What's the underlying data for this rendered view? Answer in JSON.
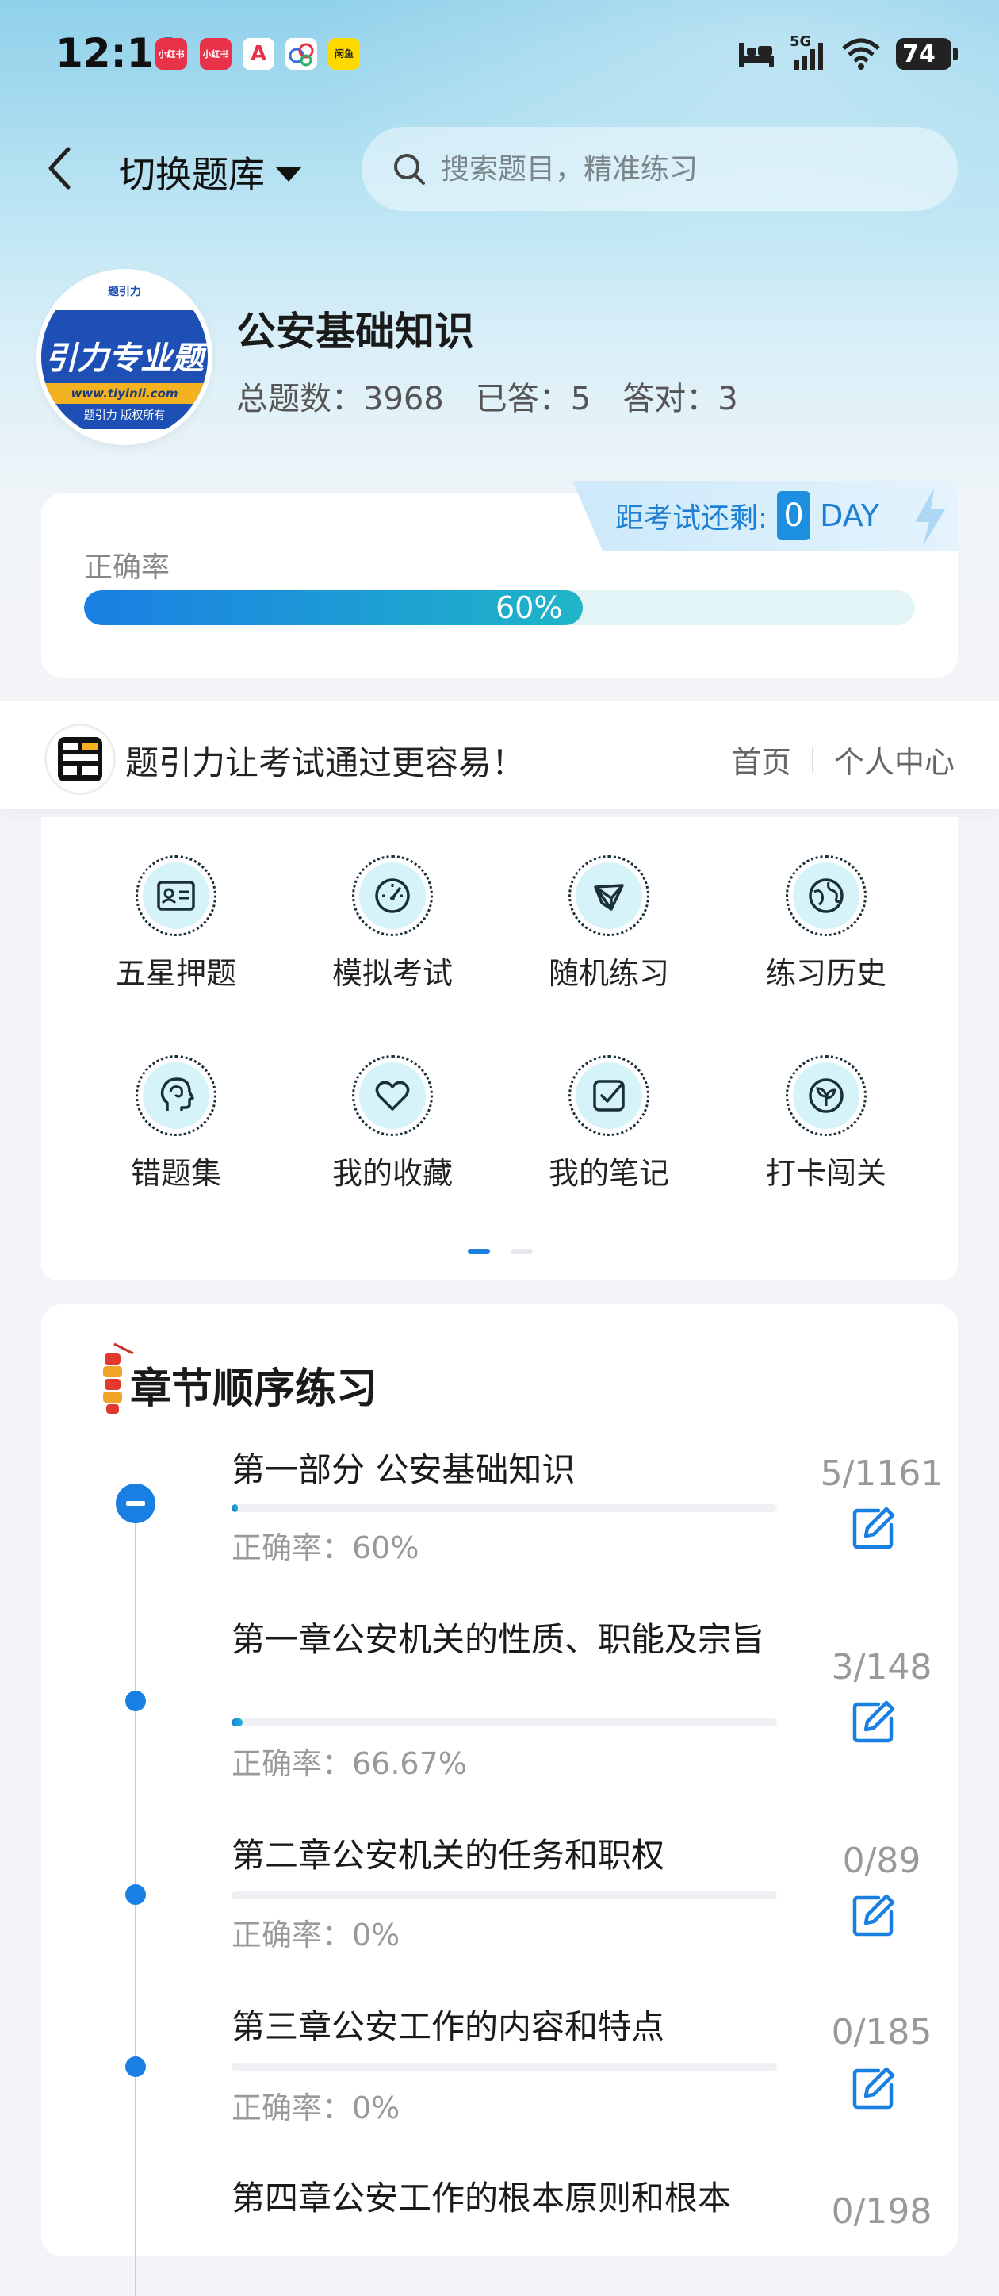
{
  "status_bar": {
    "time": "12:11",
    "apps": [
      {
        "icon": "xiaohongshu-icon",
        "label": "小红书",
        "color": "#e8324a"
      },
      {
        "icon": "xiaohongshu-icon",
        "label": "小红书",
        "color": "#e8324a"
      },
      {
        "icon": "a-app-icon",
        "label": "A",
        "color": "#e8324a"
      },
      {
        "icon": "cloud-app-icon",
        "label": "",
        "color": "#ffffff"
      },
      {
        "icon": "xianyu-icon",
        "label": "闲鱼",
        "color": "#ffd900"
      }
    ],
    "network": "5G",
    "battery": "74"
  },
  "header": {
    "switch_label": "切换题库",
    "search_placeholder": "搜索题目，精准练习"
  },
  "bank": {
    "logo_top": "题引力",
    "logo_text": "引力专业题",
    "logo_url": "www.tiyinli.com",
    "logo_copy": "题引力 版权所有",
    "title": "公安基础知识",
    "total": "总题数：3968",
    "answered": "已答：5",
    "correct": "答对：3"
  },
  "accuracy": {
    "label": "正确率",
    "percent_text": "60%",
    "fraction": 0.6,
    "countdown_label": "距考试还剩:",
    "countdown_days": "0",
    "countdown_unit": "DAY"
  },
  "banner": {
    "slogan": "题引力让考试通过更容易！",
    "link_home": "首页",
    "link_profile": "个人中心"
  },
  "features": [
    {
      "name": "five-star",
      "label": "五星押题",
      "icon": "id-card-icon"
    },
    {
      "name": "mock-exam",
      "label": "模拟考试",
      "icon": "gauge-icon"
    },
    {
      "name": "random-practice",
      "label": "随机练习",
      "icon": "network-icon"
    },
    {
      "name": "practice-history",
      "label": "练习历史",
      "icon": "globe-icon"
    },
    {
      "name": "wrong-questions",
      "label": "错题集",
      "icon": "head-icon"
    },
    {
      "name": "my-favorites",
      "label": "我的收藏",
      "icon": "heart-icon"
    },
    {
      "name": "my-notes",
      "label": "我的笔记",
      "icon": "checkbox-icon"
    },
    {
      "name": "check-in",
      "label": "打卡闯关",
      "icon": "sprout-icon"
    }
  ],
  "pager": {
    "pages": 2,
    "active": 0
  },
  "chapters": {
    "title": "章节顺序练习",
    "items": [
      {
        "title": "第一部分 公安基础知识",
        "accuracy": "正确率：60%",
        "count": "5/1161",
        "progress": 0.0043
      },
      {
        "title": "第一章公安机关的性质、职能及宗旨",
        "accuracy": "正确率：66.67%",
        "count": "3/148",
        "progress": 0.0203
      },
      {
        "title": "第二章公安机关的任务和职权",
        "accuracy": "正确率：0%",
        "count": "0/89",
        "progress": 0
      },
      {
        "title": "第三章公安工作的内容和特点",
        "accuracy": "正确率：0%",
        "count": "0/185",
        "progress": 0
      },
      {
        "title": "第四章公安工作的根本原则和根本",
        "accuracy": "",
        "count": "0/198",
        "progress": 0
      }
    ]
  }
}
